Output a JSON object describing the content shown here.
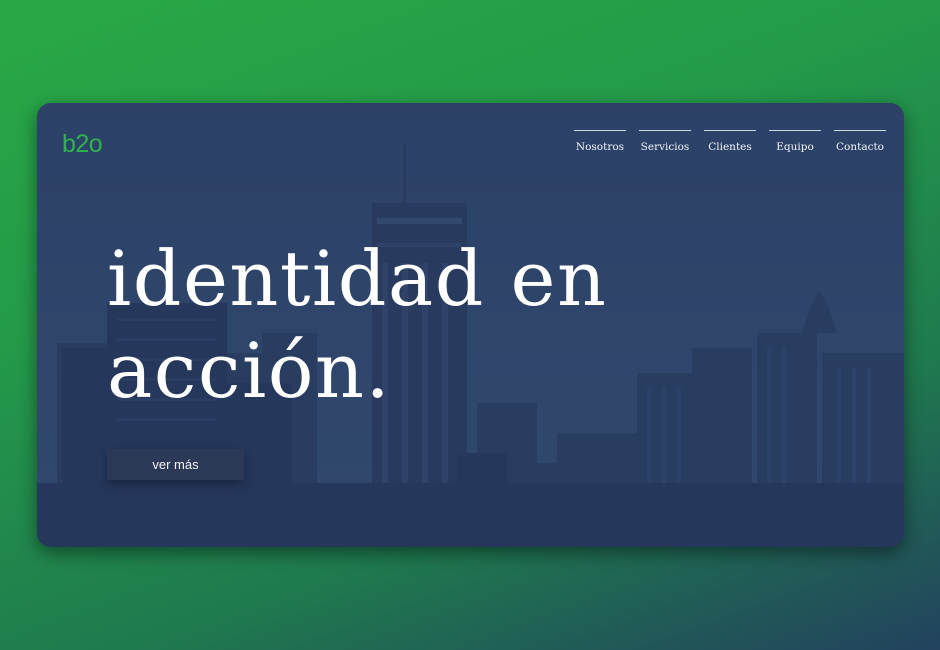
{
  "brand": {
    "logo_text": "b2o",
    "logo_color": "#2fb34c"
  },
  "nav": {
    "items": [
      {
        "label": "Nosotros"
      },
      {
        "label": "Servicios"
      },
      {
        "label": "Clientes"
      },
      {
        "label": "Equipo"
      },
      {
        "label": "Contacto"
      }
    ]
  },
  "hero": {
    "line1": "identidad en",
    "line2": "acción.",
    "cta_label": "ver más",
    "background": "city-skyline-image"
  },
  "colors": {
    "page_gradient_start": "#2aa845",
    "page_gradient_end": "#22425e",
    "card_overlay": "#2c3f63"
  }
}
